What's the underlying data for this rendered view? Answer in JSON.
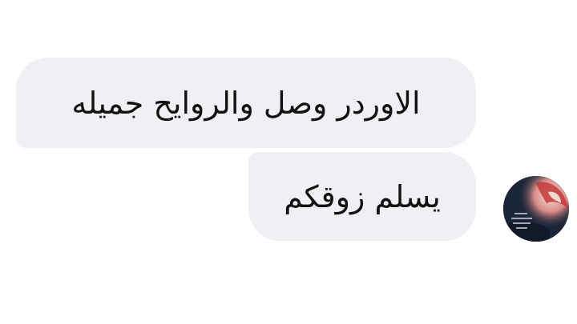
{
  "conversation": {
    "messages": [
      {
        "text": "الاوردر وصل والروايح جميله"
      },
      {
        "text": "يسلم زوقكم"
      }
    ]
  },
  "avatar": {
    "icon": "profile-photo",
    "accent": "#c23a3a",
    "background": "#1e2a3f"
  }
}
